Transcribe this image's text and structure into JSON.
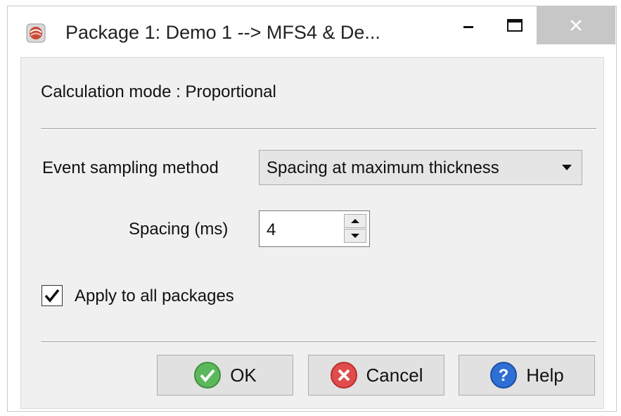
{
  "window": {
    "title": "Package 1: Demo 1 --> MFS4 & De..."
  },
  "titlebar": {
    "minimize_icon": "minimize-icon",
    "maximize_icon": "maximize-icon",
    "close_icon": "close-icon"
  },
  "content": {
    "calculation_mode": "Calculation mode : Proportional",
    "event_sampling_label": "Event sampling method",
    "event_sampling_value": "Spacing at maximum thickness",
    "spacing_label": "Spacing (ms)",
    "spacing_value": "4",
    "apply_all_label": "Apply to all packages",
    "apply_all_checked": true
  },
  "buttons": {
    "ok": "OK",
    "cancel": "Cancel",
    "help": "Help"
  },
  "colors": {
    "ok_green": "#5cb85c",
    "cancel_red": "#e04b4b",
    "help_blue": "#2e6fd6",
    "close_bg": "#c7c7c7"
  }
}
